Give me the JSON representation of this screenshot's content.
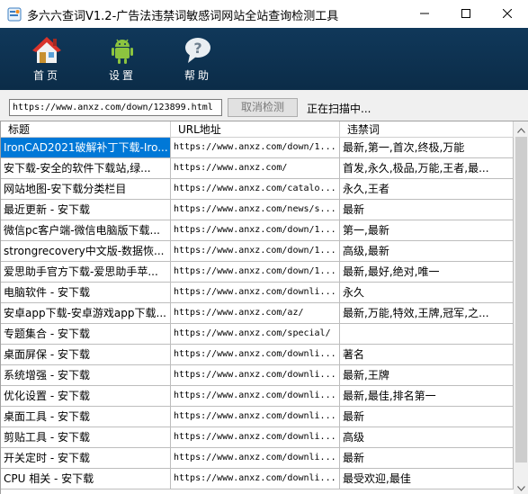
{
  "window": {
    "title": "多六六查词V1.2-广告法违禁词敏感词网站全站查询检测工具",
    "app_icon": "app-logo-icon",
    "controls": [
      "minimize-icon",
      "maximize-icon",
      "close-icon"
    ]
  },
  "toolbar": {
    "items": [
      {
        "label": "首页",
        "icon": "home-icon"
      },
      {
        "label": "设置",
        "icon": "android-settings-icon"
      },
      {
        "label": "帮助",
        "icon": "help-bubble-icon"
      }
    ]
  },
  "controls": {
    "url_value": "https://www.anxz.com/down/123899.html",
    "cancel_label": "取消检测",
    "status": "正在扫描中..."
  },
  "table": {
    "columns": [
      "标题",
      "URL地址",
      "违禁词"
    ],
    "selected_row": 0,
    "rows": [
      {
        "title": "IronCAD2021破解补丁下载-Iro...",
        "url": "https://www.anxz.com/down/1...",
        "words": "最新,第一,首次,终极,万能"
      },
      {
        "title": "安下载-安全的软件下载站,绿...",
        "url": "https://www.anxz.com/",
        "words": "首发,永久,极品,万能,王者,最..."
      },
      {
        "title": "网站地图-安下载分类栏目",
        "url": "https://www.anxz.com/catalo...",
        "words": "永久,王者"
      },
      {
        "title": "最近更新 - 安下载",
        "url": "https://www.anxz.com/news/s...",
        "words": "最新"
      },
      {
        "title": "微信pc客户端-微信电脑版下载...",
        "url": "https://www.anxz.com/down/1...",
        "words": "第一,最新"
      },
      {
        "title": "strongrecovery中文版-数据恢...",
        "url": "https://www.anxz.com/down/1...",
        "words": "高级,最新"
      },
      {
        "title": "爱思助手官方下载-爱思助手苹...",
        "url": "https://www.anxz.com/down/1...",
        "words": "最新,最好,绝对,唯一"
      },
      {
        "title": "电脑软件  - 安下载",
        "url": "https://www.anxz.com/downli...",
        "words": "永久"
      },
      {
        "title": "安卓app下载-安卓游戏app下载...",
        "url": "https://www.anxz.com/az/",
        "words": "最新,万能,特效,王牌,冠军,之..."
      },
      {
        "title": "专题集合 - 安下载",
        "url": "https://www.anxz.com/special/",
        "words": ""
      },
      {
        "title": "桌面屏保  - 安下载",
        "url": "https://www.anxz.com/downli...",
        "words": "著名"
      },
      {
        "title": "系统增强  - 安下载",
        "url": "https://www.anxz.com/downli...",
        "words": "最新,王牌"
      },
      {
        "title": "优化设置  - 安下载",
        "url": "https://www.anxz.com/downli...",
        "words": "最新,最佳,排名第一"
      },
      {
        "title": "桌面工具  - 安下载",
        "url": "https://www.anxz.com/downli...",
        "words": "最新"
      },
      {
        "title": "剪贴工具  - 安下载",
        "url": "https://www.anxz.com/downli...",
        "words": "高级"
      },
      {
        "title": "开关定时  - 安下载",
        "url": "https://www.anxz.com/downli...",
        "words": "最新"
      },
      {
        "title": "CPU 相关  - 安下载",
        "url": "https://www.anxz.com/downli...",
        "words": "最受欢迎,最佳"
      }
    ]
  },
  "colors": {
    "toolbar_bg": "#0f3556",
    "selection": "#0078d7"
  }
}
